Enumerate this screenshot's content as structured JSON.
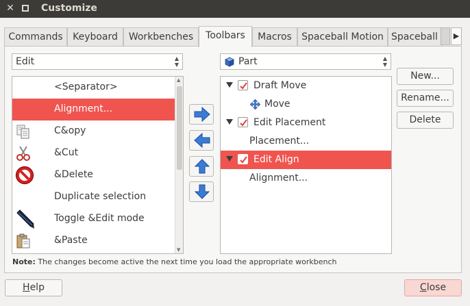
{
  "window": {
    "title": "Customize",
    "close_glyph": "✕"
  },
  "tabs": [
    {
      "label": "Commands",
      "active": false
    },
    {
      "label": "Keyboard",
      "active": false
    },
    {
      "label": "Workbenches",
      "active": false
    },
    {
      "label": "Toolbars",
      "active": true
    },
    {
      "label": "Macros",
      "active": false
    },
    {
      "label": "Spaceball Motion",
      "active": false
    },
    {
      "label": "Spaceball B",
      "active": false
    }
  ],
  "tab_scroll_arrow": "▶",
  "category_combo": {
    "value": "Edit"
  },
  "workbench_combo": {
    "value": "Part"
  },
  "commands": [
    {
      "label": "<Separator>",
      "icon": "none",
      "selected": false
    },
    {
      "label": "Alignment...",
      "icon": "none",
      "selected": true
    },
    {
      "label": "C&opy",
      "icon": "copy-icon",
      "selected": false
    },
    {
      "label": "&Cut",
      "icon": "scissors-icon",
      "selected": false
    },
    {
      "label": "&Delete",
      "icon": "delete-icon",
      "selected": false
    },
    {
      "label": "Duplicate selection",
      "icon": "none",
      "selected": false
    },
    {
      "label": "Toggle &Edit mode",
      "icon": "pencil-icon",
      "selected": false
    },
    {
      "label": "&Paste",
      "icon": "paste-icon",
      "selected": false
    }
  ],
  "toolbar_tree": [
    {
      "label": "Draft Move",
      "level": 0,
      "checked": true,
      "expanded": true,
      "selected": false
    },
    {
      "label": "Move",
      "level": 1,
      "icon": "move-icon",
      "selected": false
    },
    {
      "label": "Edit Placement",
      "level": 0,
      "checked": true,
      "expanded": true,
      "selected": false
    },
    {
      "label": "Placement...",
      "level": 1,
      "selected": false
    },
    {
      "label": "Edit Align",
      "level": 0,
      "checked": true,
      "expanded": true,
      "selected": true
    },
    {
      "label": "Alignment...",
      "level": 1,
      "selected": false
    }
  ],
  "side_buttons": {
    "new": "New...",
    "rename": "Rename...",
    "delete": "Delete"
  },
  "note": {
    "prefix": "Note:",
    "text": " The changes become active the next time you load the appropriate workbench"
  },
  "buttons": {
    "help_u": "H",
    "help_rest": "elp",
    "close_u": "C",
    "close_rest": "lose"
  },
  "colors": {
    "selection": "#f0544f",
    "titlebar": "#3c3b37",
    "accent_blue": "#3a7bd5",
    "close_button": "#f9d7d3"
  }
}
